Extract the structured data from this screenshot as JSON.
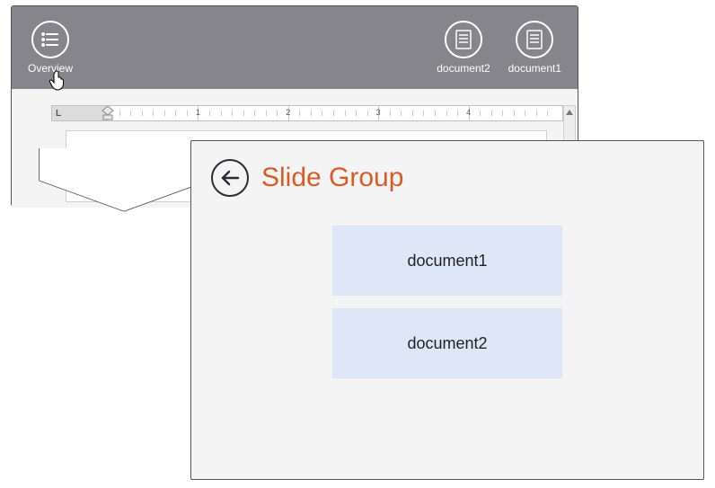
{
  "toolbar": {
    "overview": {
      "label": "Overview"
    },
    "docs": [
      {
        "label": "document2"
      },
      {
        "label": "document1"
      }
    ]
  },
  "ruler": {
    "numbers": [
      "1",
      "2",
      "3",
      "4"
    ]
  },
  "slide_group": {
    "title": "Slide Group",
    "tiles": [
      {
        "label": "document1"
      },
      {
        "label": "document2"
      }
    ]
  }
}
